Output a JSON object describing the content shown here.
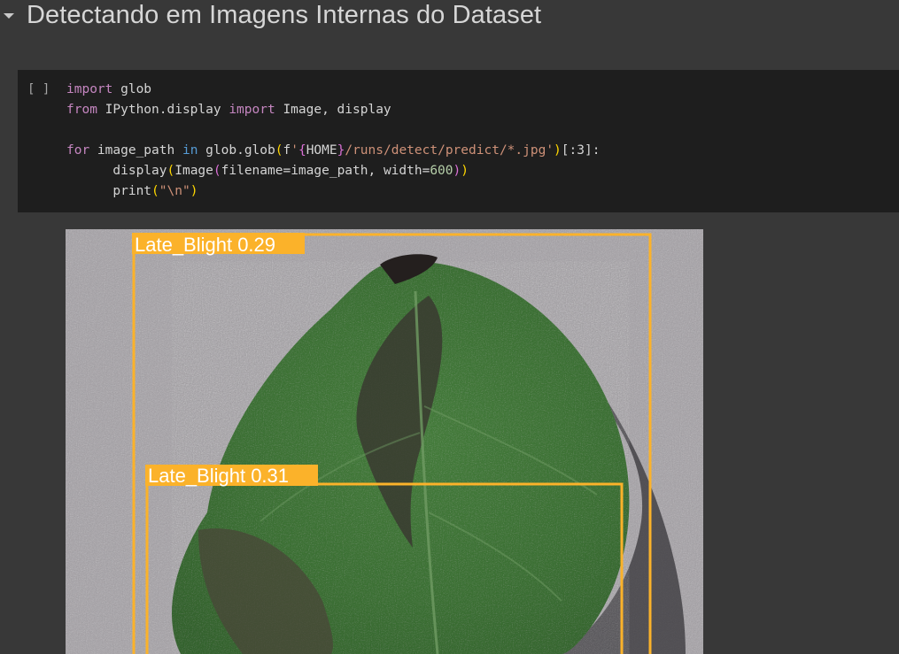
{
  "section": {
    "title": "Detectando em Imagens Internas do Dataset",
    "caret_icon": "caret-down-icon"
  },
  "code_cell": {
    "run_indicator": "[ ]",
    "lines": [
      "import glob",
      "from IPython.display import Image, display",
      "",
      "for image_path in glob.glob(f'{HOME}/runs/detect/predict/*.jpg')[:3]:",
      "      display(Image(filename=image_path, width=600))",
      "      print(\"\\n\")"
    ]
  },
  "output": {
    "image_subject": "potato leaf",
    "box_color": "#fbb22a",
    "detections": [
      {
        "label": "Late_Blight 0.29"
      },
      {
        "label": "Late_Blight 0.31"
      }
    ]
  },
  "colors": {
    "page_bg": "#383838",
    "cell_bg": "#1e1e1e",
    "title_text": "#d6d6d6"
  }
}
